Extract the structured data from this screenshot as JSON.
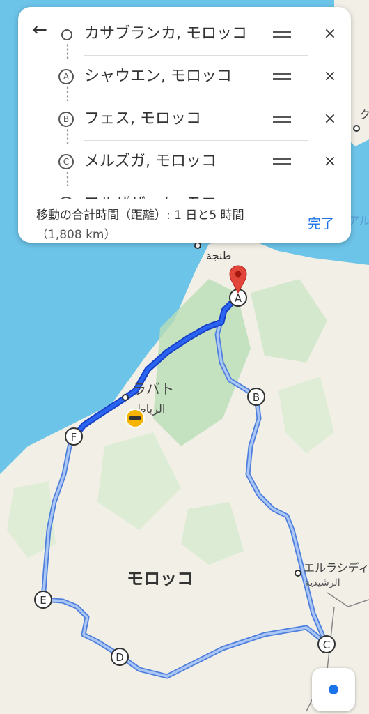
{
  "route": {
    "stops": [
      {
        "marker": "",
        "label": "カサブランカ, モロッコ"
      },
      {
        "marker": "A",
        "label": "シャウエン, モロッコ"
      },
      {
        "marker": "B",
        "label": "フェス, モロッコ"
      },
      {
        "marker": "C",
        "label": "メルズガ, モロッコ"
      },
      {
        "marker": "D",
        "label": "ワルザザート, モロッ"
      }
    ],
    "summary_time": "移動の合計時間（距離）: 1 日と5 時間",
    "summary_distance": "（1,808 km）",
    "done_label": "完了"
  },
  "map": {
    "country_label": "モロッコ",
    "cities": {
      "tangier_ar": "طنجة",
      "rabat": "ラバト",
      "rabat_ar": "الرباط",
      "errachidia": "エルラシディ",
      "errachidia_ar": "الرشيدية",
      "right_edge_1": "アル",
      "right_edge_2": "ク"
    },
    "waypoints": [
      "A",
      "B",
      "C",
      "D",
      "E",
      "F"
    ]
  },
  "colors": {
    "sea": "#6cc4e8",
    "land": "#f1efe6",
    "park": "#b9dfb5",
    "route_primary": "#1a56e8",
    "route_alt": "#7aa7f0",
    "pin": "#e2463b",
    "accent": "#1a73e8"
  }
}
